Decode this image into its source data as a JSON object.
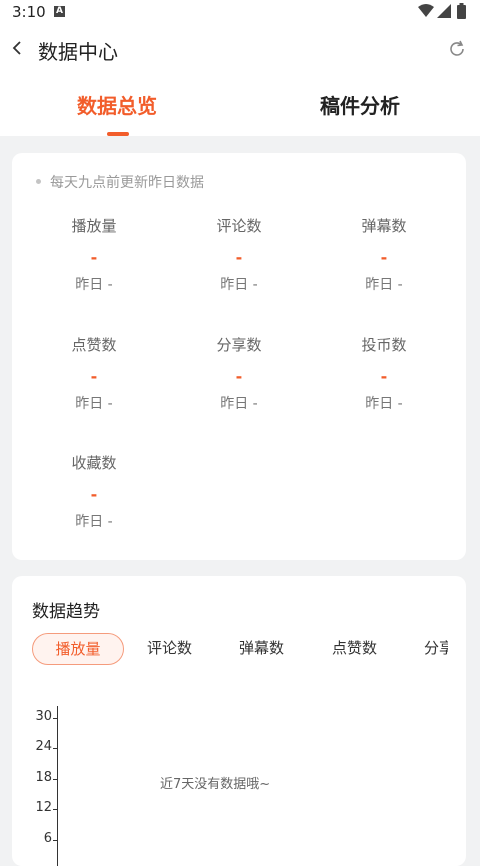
{
  "status_bar": {
    "time": "3:10",
    "notification_icon": "a-letter-icon"
  },
  "header": {
    "title": "数据中心",
    "back_icon": "chevron-left-icon",
    "refresh_icon": "refresh-icon"
  },
  "tabs": [
    {
      "label": "数据总览",
      "active": true
    },
    {
      "label": "稿件分析",
      "active": false
    }
  ],
  "overview": {
    "note": "每天九点前更新昨日数据",
    "metrics": [
      {
        "label": "播放量",
        "value": "-",
        "yesterday": "昨日 -"
      },
      {
        "label": "评论数",
        "value": "-",
        "yesterday": "昨日 -"
      },
      {
        "label": "弹幕数",
        "value": "-",
        "yesterday": "昨日 -"
      },
      {
        "label": "点赞数",
        "value": "-",
        "yesterday": "昨日 -"
      },
      {
        "label": "分享数",
        "value": "-",
        "yesterday": "昨日 -"
      },
      {
        "label": "投币数",
        "value": "-",
        "yesterday": "昨日 -"
      },
      {
        "label": "收藏数",
        "value": "-",
        "yesterday": "昨日 -"
      }
    ]
  },
  "trend": {
    "title": "数据趋势",
    "pills": [
      "播放量",
      "评论数",
      "弹幕数",
      "点赞数",
      "分享"
    ],
    "selected_pill": "播放量",
    "y_ticks": [
      "30",
      "24",
      "18",
      "12",
      "6"
    ],
    "empty_message": "近7天没有数据哦~"
  },
  "colors": {
    "accent": "#f25d2b",
    "background": "#f1f2f3",
    "card": "#ffffff"
  }
}
